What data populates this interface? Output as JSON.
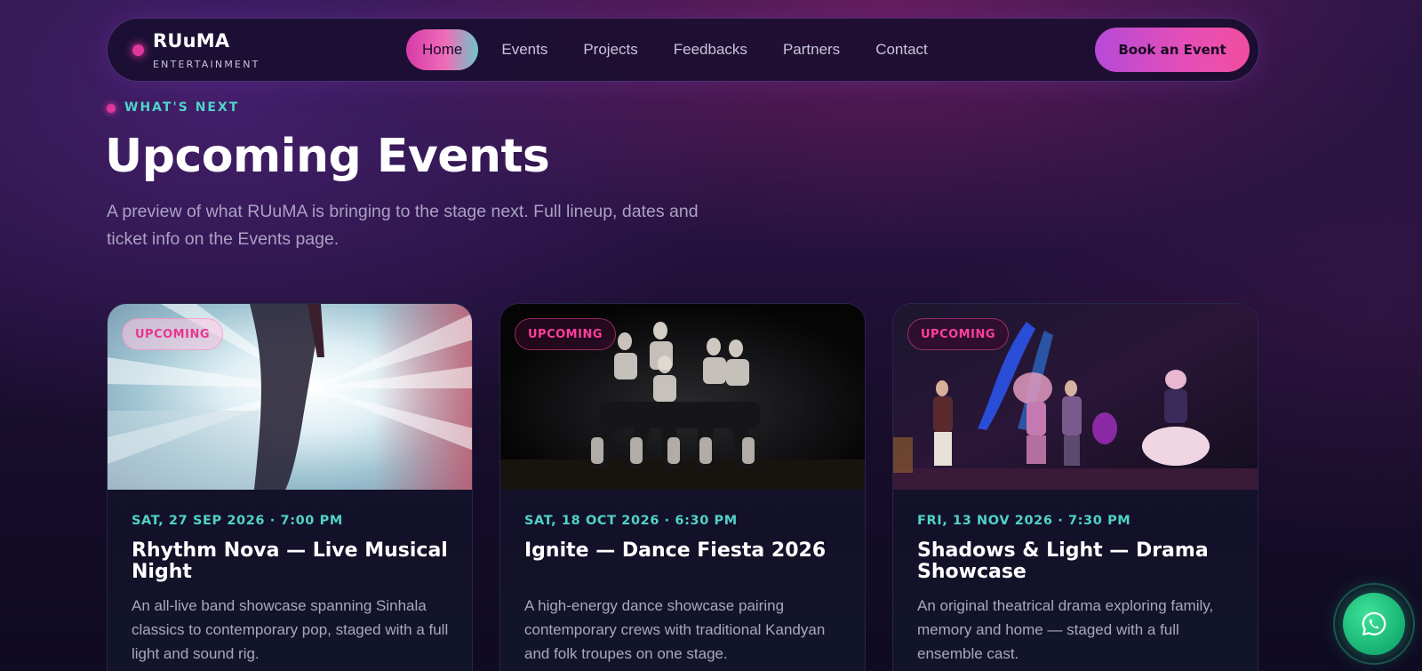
{
  "brand": {
    "name": "RUuMA",
    "tagline": "ENTERTAINMENT"
  },
  "nav": {
    "items": [
      {
        "label": "Home",
        "active": true
      },
      {
        "label": "Events"
      },
      {
        "label": "Projects"
      },
      {
        "label": "Feedbacks"
      },
      {
        "label": "Partners"
      },
      {
        "label": "Contact"
      }
    ],
    "cta": "Book an Event"
  },
  "section": {
    "eyebrow": "WHAT'S NEXT",
    "title": "Upcoming Events",
    "lead": "A preview of what RUuMA is bringing to the stage next. Full lineup, dates and ticket info on the Events page."
  },
  "events": [
    {
      "badge": "UPCOMING",
      "date": "SAT, 27 SEP 2026 · 7:00 PM",
      "title": "Rhythm Nova — Live Musical Night",
      "description": "An all-live band showcase spanning Sinhala classics to contemporary pop, staged with a full light and sound rig."
    },
    {
      "badge": "UPCOMING",
      "date": "SAT, 18 OCT 2026 · 6:30 PM",
      "title": "Ignite — Dance Fiesta 2026",
      "description": "A high-energy dance showcase pairing contemporary crews with traditional Kandyan and folk troupes on one stage."
    },
    {
      "badge": "UPCOMING",
      "date": "FRI, 13 NOV 2026 · 7:30 PM",
      "title": "Shadows & Light — Drama Showcase",
      "description": "An original theatrical drama exploring family, memory and home — staged with a full ensemble cast."
    }
  ],
  "colors": {
    "accent_pink": "#e0379d",
    "accent_teal": "#4fd3c8",
    "whatsapp_green": "#16b072"
  },
  "icons": {
    "floating": "whatsapp-icon"
  }
}
